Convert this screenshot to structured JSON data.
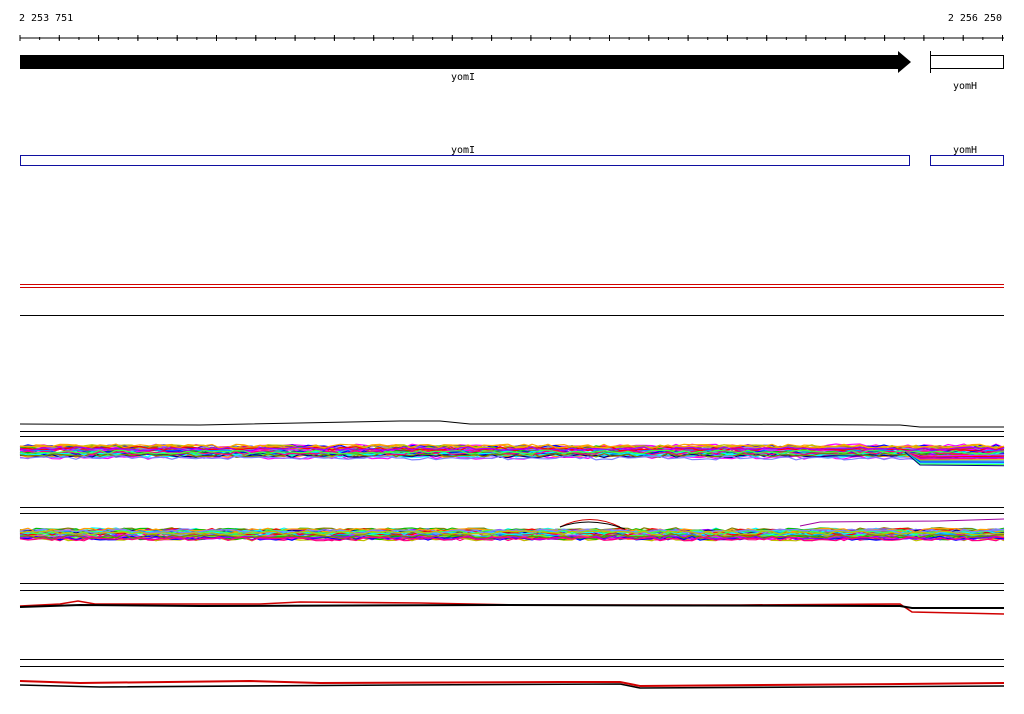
{
  "ruler": {
    "start_label": "2 253 751",
    "end_label": "2 256 250"
  },
  "genes": [
    {
      "name": "yomI",
      "strand": "forward",
      "style": "filled-arrow"
    },
    {
      "name": "yomH",
      "strand": "reverse",
      "style": "open-box"
    }
  ],
  "annotation_track": {
    "features": [
      {
        "name": "yomI"
      },
      {
        "name": "yomH"
      }
    ]
  },
  "colors": {
    "gene_fill": "#000000",
    "annotation_stroke": "#1010a0",
    "profile_red": "#d00000",
    "profile_black": "#000000",
    "track_separator": "#000000"
  },
  "profile_palette": [
    "#ff00ff",
    "#00a0ff",
    "#00c000",
    "#ff0000",
    "#0000ff",
    "#ffa000",
    "#a000ff",
    "#00ffff",
    "#808000",
    "#ff0080",
    "#40ff40",
    "#8080ff",
    "#c0c000",
    "#000080"
  ]
}
